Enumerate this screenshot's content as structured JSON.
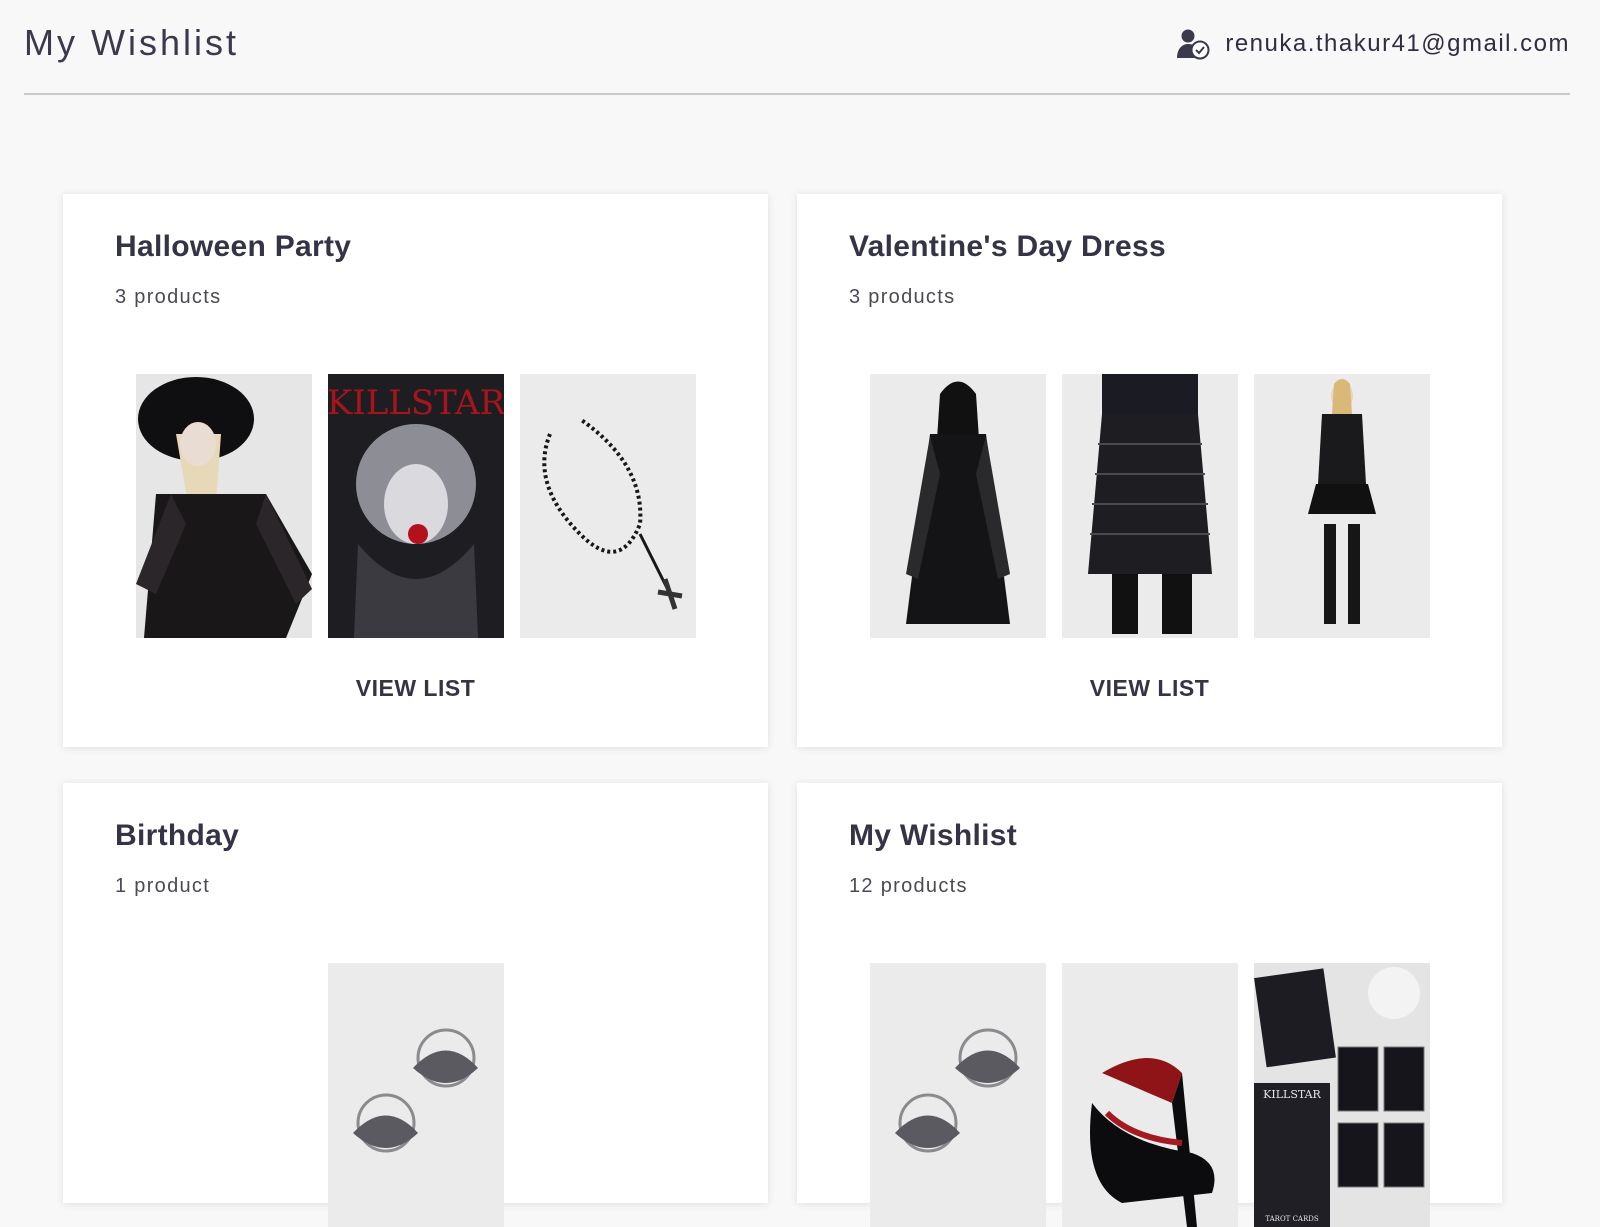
{
  "header": {
    "title": "My Wishlist",
    "account_icon": "user-verified-icon",
    "email": "renuka.thakur41@gmail.com"
  },
  "lists": [
    {
      "title": "Halloween Party",
      "count": "3 products",
      "action": "VIEW LIST",
      "products": [
        "witch-hat-mesh-top",
        "graphic-longsleeve-tee",
        "cross-bead-necklace"
      ]
    },
    {
      "title": "Valentine's Day Dress",
      "count": "3 products",
      "action": "VIEW LIST",
      "products": [
        "black-chiffon-dress",
        "tiered-ruffle-maxi-skirt",
        "lace-top-and-mini-skirt"
      ]
    },
    {
      "title": "Birthday",
      "count": "1 product",
      "products": [
        "moth-hoop-earrings"
      ]
    },
    {
      "title": "My Wishlist",
      "count": "12 products",
      "products": [
        "moth-hoop-earrings",
        "bat-wing-heels",
        "tarot-cards"
      ]
    }
  ],
  "tarot_image": {
    "brand_text": "KILLSTAR",
    "caption_text": "TAROT CARDS"
  }
}
